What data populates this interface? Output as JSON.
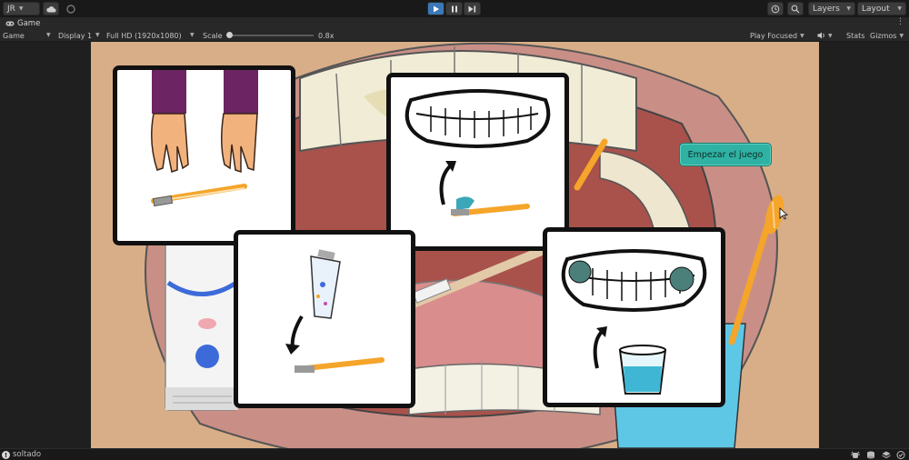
{
  "toolbar": {
    "account_label": "JR",
    "layers_label": "Layers",
    "layout_label": "Layout"
  },
  "tabs": {
    "game_tab": "Game"
  },
  "gamebar": {
    "mode": "Game",
    "display": "Display 1",
    "resolution": "Full HD (1920x1080)",
    "scale_label": "Scale",
    "scale_value": "0.8x",
    "play_focused": "Play Focused",
    "stats": "Stats",
    "gizmos": "Gizmos"
  },
  "game": {
    "start_button": "Empezar el juego"
  },
  "status": {
    "message": "soltado"
  },
  "colors": {
    "accent_play": "#3a78b8",
    "start_button": "#2fb2a3",
    "scene_bg": "#d8ae88",
    "cup": "#5ec7e6",
    "brush_orange": "#f4a52a"
  },
  "icons": [
    "cloud-icon",
    "collab-icon",
    "play-icon",
    "pause-icon",
    "step-icon",
    "history-icon",
    "search-icon",
    "audio-icon",
    "kebab-icon",
    "info-icon",
    "cursor-icon"
  ]
}
